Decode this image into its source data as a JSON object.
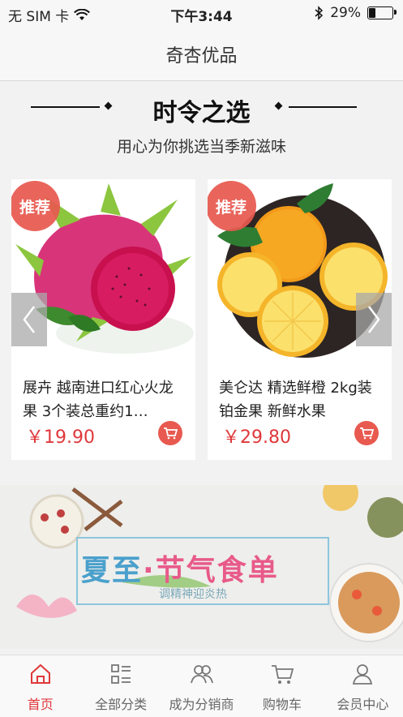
{
  "status_bar": {
    "carrier": "无 SIM 卡",
    "time": "下午3:44",
    "battery_text": "29%",
    "battery_level": 0.29
  },
  "nav": {
    "title": "奇杏优品"
  },
  "section": {
    "title": "时令之选",
    "subtitle": "用心为你挑选当季新滋味"
  },
  "products": [
    {
      "badge": "推荐",
      "title": "展卉 越南进口红心火龙果 3个装总重约1…",
      "price": "￥19.90"
    },
    {
      "badge": "推荐",
      "title": "美仑达 精选鲜橙 2kg装 铂金果 新鲜水果",
      "price": "￥29.80"
    }
  ],
  "banner": {
    "title_part1": "夏至",
    "title_dot": "·",
    "title_part2": "节气食单",
    "subtitle": "调精神迎炎热"
  },
  "tabbar": {
    "items": [
      {
        "label": "首页",
        "icon": "home-icon",
        "active": true
      },
      {
        "label": "全部分类",
        "icon": "category-icon"
      },
      {
        "label": "成为分销商",
        "icon": "users-icon"
      },
      {
        "label": "购物车",
        "icon": "cart-icon"
      },
      {
        "label": "会员中心",
        "icon": "user-icon"
      }
    ]
  },
  "colors": {
    "accent": "#e0383b",
    "badge": "#e8594f"
  }
}
